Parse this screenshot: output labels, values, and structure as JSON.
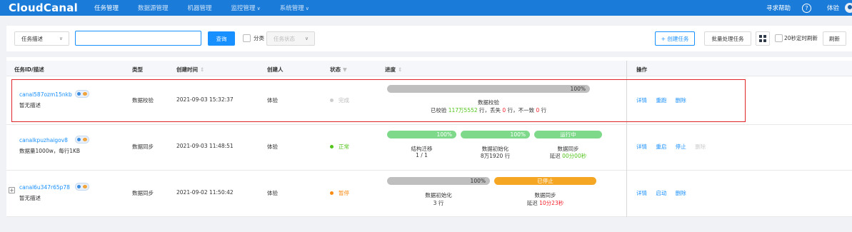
{
  "nav": {
    "logo": "CloudCanal",
    "items": [
      {
        "label": "任务管理",
        "caret": ""
      },
      {
        "label": "数据源管理",
        "caret": ""
      },
      {
        "label": "机器管理",
        "caret": ""
      },
      {
        "label": "监控管理",
        "caret": "∨"
      },
      {
        "label": "系统管理",
        "caret": "∨"
      }
    ],
    "help": "寻求帮助",
    "user": "体验"
  },
  "toolbar": {
    "filter_select": "任务描述",
    "search_value": "",
    "search_button": "查询",
    "classify_label": "分类",
    "status_select": "任务状态",
    "create_button": "+ 创建任务",
    "batch_button": "批量处理任务",
    "auto_refresh_label": "20秒定时刷新",
    "refresh_button": "刷新"
  },
  "table": {
    "headers": {
      "id": "任务ID/描述",
      "type": "类型",
      "created": "创建时间",
      "creator": "创建人",
      "status": "状态",
      "progress": "进度",
      "actions": "操作"
    },
    "rows": [
      {
        "id": "canal587ozm15nkb",
        "desc": "暂无描述",
        "type": "数据校验",
        "created": "2021-09-03 15:32:37",
        "creator": "体验",
        "status": "完成",
        "status_color": "#cccccc",
        "progress": {
          "bar1": "100%",
          "stage": "数据校验",
          "detail_pre": "已校验 ",
          "verified": "117万5552",
          "detail_mid1": " 行，丢失 ",
          "lost": "0",
          "detail_mid2": " 行，不一致 ",
          "mismatch": "0",
          "detail_post": " 行"
        },
        "actions": [
          "详情",
          "重跑",
          "删除"
        ]
      },
      {
        "id": "canalkpuzhaigov8",
        "desc": "数据量1000w，每行1KB",
        "type": "数据同步",
        "created": "2021-09-03 11:48:51",
        "creator": "体验",
        "status": "正常",
        "status_color": "#52c41a",
        "progress": {
          "bar1": "100%",
          "bar2": "100%",
          "bar3": "运行中",
          "stage1": "结构迁移",
          "stage1_val": "1 / 1",
          "stage2": "数据初始化",
          "stage2_val": "8万1920 行",
          "stage3": "数据同步",
          "stage3_pre": "延迟 ",
          "stage3_val": "00分00秒"
        },
        "actions": [
          "详情",
          "重启",
          "停止",
          "删除"
        ]
      },
      {
        "id": "canal6u347r65p78",
        "desc": "暂无描述",
        "type": "数据同步",
        "created": "2021-09-02 11:50:42",
        "creator": "体验",
        "status": "暂停",
        "status_color": "#fa8c16",
        "progress": {
          "bar1": "100%",
          "bar2": "已停止",
          "stage1": "数据初始化",
          "stage1_val": "3 行",
          "stage2": "数据同步",
          "stage2_pre": "延迟 ",
          "stage2_val": "10分23秒"
        },
        "actions": [
          "详情",
          "启动",
          "删除"
        ]
      }
    ]
  }
}
